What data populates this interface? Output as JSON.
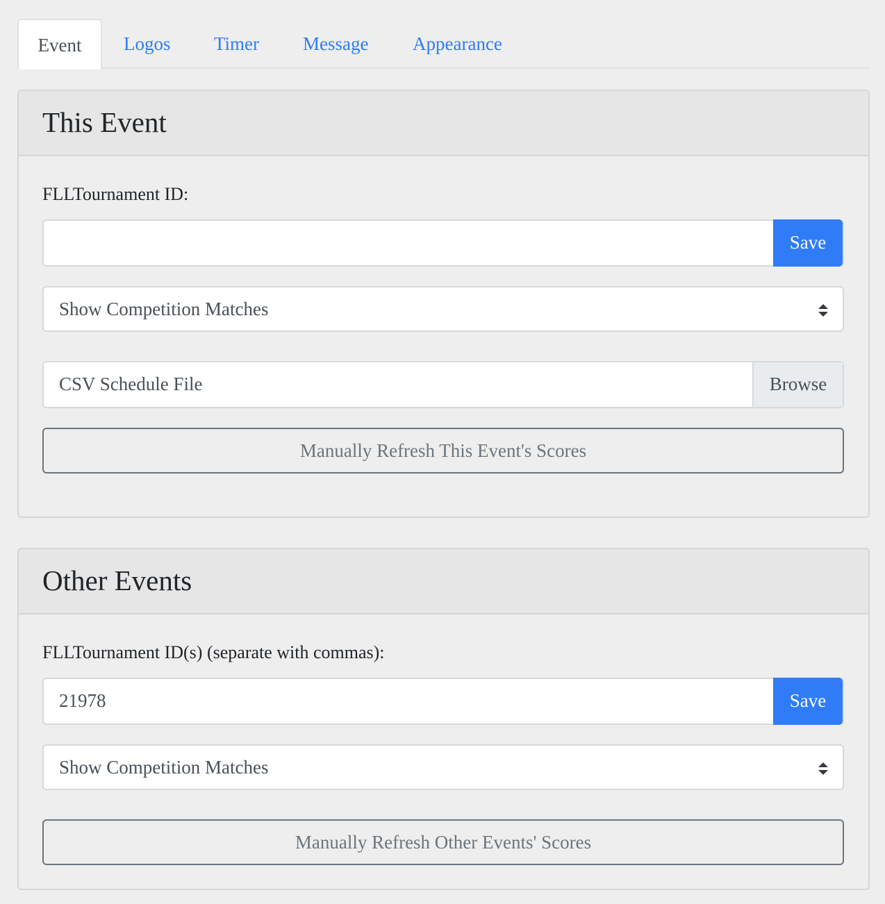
{
  "tabs": [
    {
      "label": "Event",
      "active": true
    },
    {
      "label": "Logos"
    },
    {
      "label": "Timer"
    },
    {
      "label": "Message"
    },
    {
      "label": "Appearance"
    }
  ],
  "this_event": {
    "title": "This Event",
    "id_label": "FLLTournament ID:",
    "id_value": "",
    "save": "Save",
    "select": "Show Competition Matches",
    "file_placeholder": "CSV Schedule File",
    "browse": "Browse",
    "refresh": "Manually Refresh This Event's Scores"
  },
  "other_events": {
    "title": "Other Events",
    "id_label": "FLLTournament ID(s) (separate with commas):",
    "id_value": "21978",
    "save": "Save",
    "select": "Show Competition Matches",
    "refresh": "Manually Refresh Other Events' Scores"
  },
  "colors": {
    "accent": "#2f7cf6",
    "background": "#eeeeee"
  }
}
